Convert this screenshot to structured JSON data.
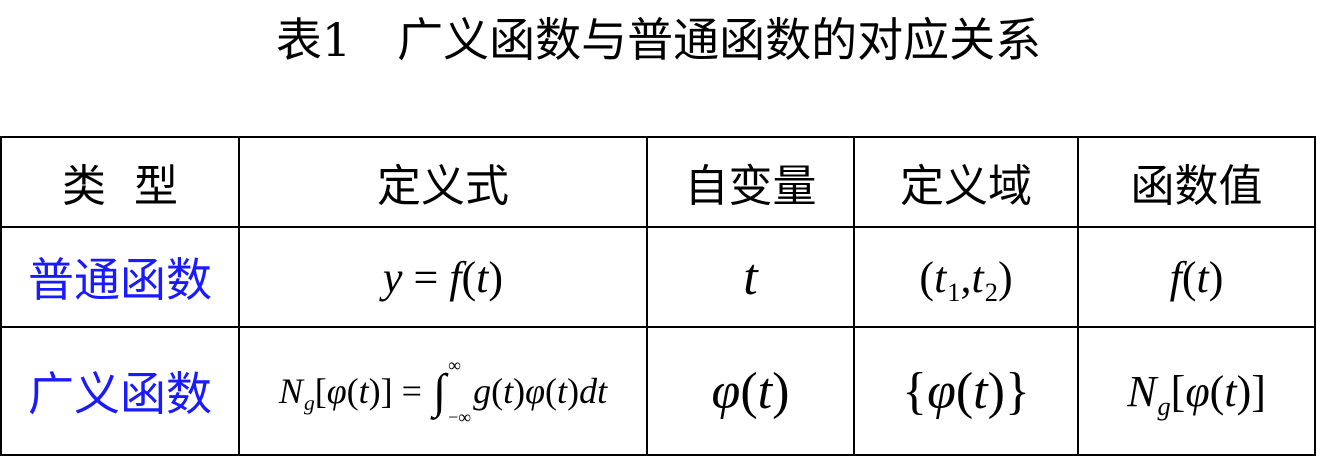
{
  "title": "表1　广义函数与普通函数的对应关系",
  "table": {
    "headers": [
      "类  型",
      "定义式",
      "自变量",
      "定义域",
      "函数值"
    ],
    "rows": [
      {
        "type": "普通函数",
        "definition": "y = f(t)",
        "variable": "t",
        "domain": "(t1, t2)",
        "value": "f(t)"
      },
      {
        "type": "广义函数",
        "definition": "Ng[φ(t)] = ∫−∞∞ g(t)φ(t)dt",
        "variable": "φ(t)",
        "domain": "{φ(t)}",
        "value": "Ng[φ(t)]"
      }
    ],
    "colors": {
      "row_label": "#1a1aff",
      "border": "#000000"
    }
  }
}
